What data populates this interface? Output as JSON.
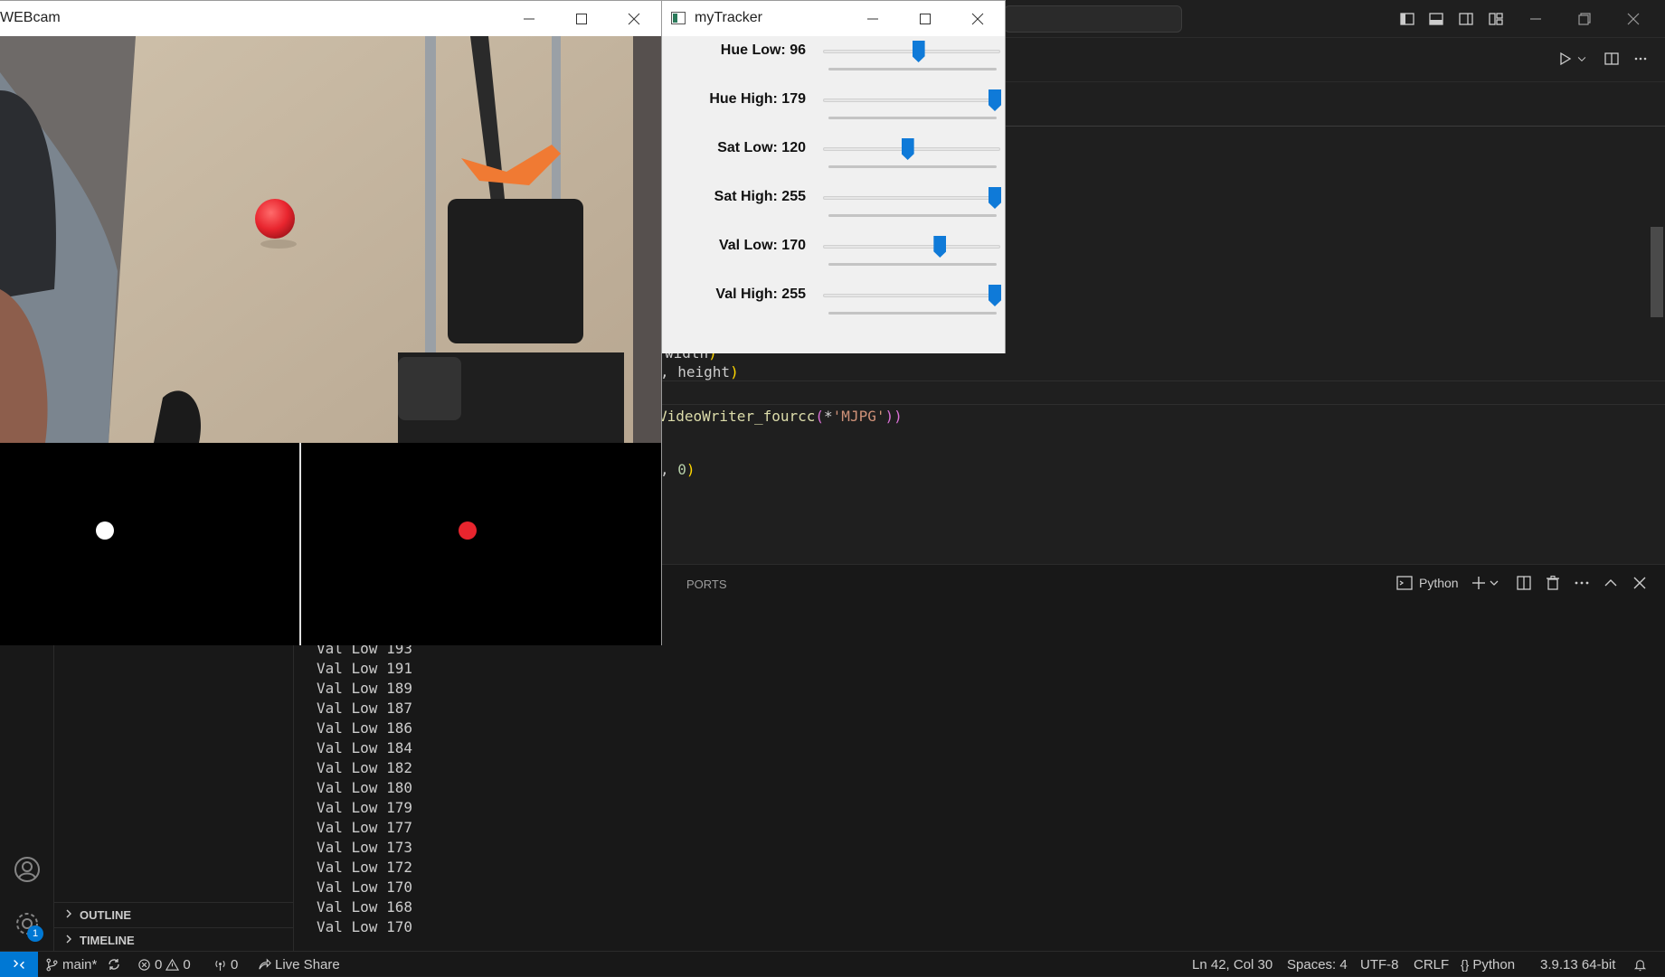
{
  "vscode": {
    "terminal_tabs": {
      "ports": "PORTS"
    },
    "terminal_shell": "Python",
    "code_lines": [
      {
        "plain": "width",
        "suffix": ")"
      },
      {
        "plain": ", height",
        "suffix": ")"
      },
      {
        "plain": "VideoWriter_fourcc",
        "paren": "(",
        "star": "*",
        "str": "'MJPG'",
        "close": "))"
      },
      {
        "plain": ", ",
        "num": "0",
        "close": ")"
      }
    ],
    "terminal_lines": [
      "Val Low 193",
      "Val Low 191",
      "Val Low 189",
      "Val Low 187",
      "Val Low 186",
      "Val Low 184",
      "Val Low 182",
      "Val Low 180",
      "Val Low 179",
      "Val Low 177",
      "Val Low 173",
      "Val Low 172",
      "Val Low 170",
      "Val Low 168",
      "Val Low 170"
    ],
    "sidebar": {
      "outline": "OUTLINE",
      "timeline": "TIMELINE"
    },
    "accounts_badge": "1",
    "statusbar": {
      "branch": "main*",
      "errors": "0",
      "warnings": "0",
      "ports": "0",
      "live_share": "Live Share",
      "cursor": "Ln 42, Col 30",
      "spaces": "Spaces: 4",
      "encoding": "UTF-8",
      "eol": "CRLF",
      "language": "Python",
      "interpreter": "3.9.13 64-bit"
    }
  },
  "webcam_window": {
    "title": "WEBcam"
  },
  "tracker_window": {
    "title": "myTracker",
    "sliders": [
      {
        "label": "Hue Low: 96",
        "value": 96,
        "max": 179
      },
      {
        "label": "Hue High: 179",
        "value": 179,
        "max": 179
      },
      {
        "label": "Sat Low: 120",
        "value": 120,
        "max": 255
      },
      {
        "label": "Sat High: 255",
        "value": 255,
        "max": 255
      },
      {
        "label": "Val Low: 170",
        "value": 170,
        "max": 255
      },
      {
        "label": "Val High: 255",
        "value": 255,
        "max": 255
      }
    ]
  },
  "colors": {
    "accent": "#0078d4",
    "slider_thumb": "#0f7ad8",
    "ball": "#e8252e"
  }
}
